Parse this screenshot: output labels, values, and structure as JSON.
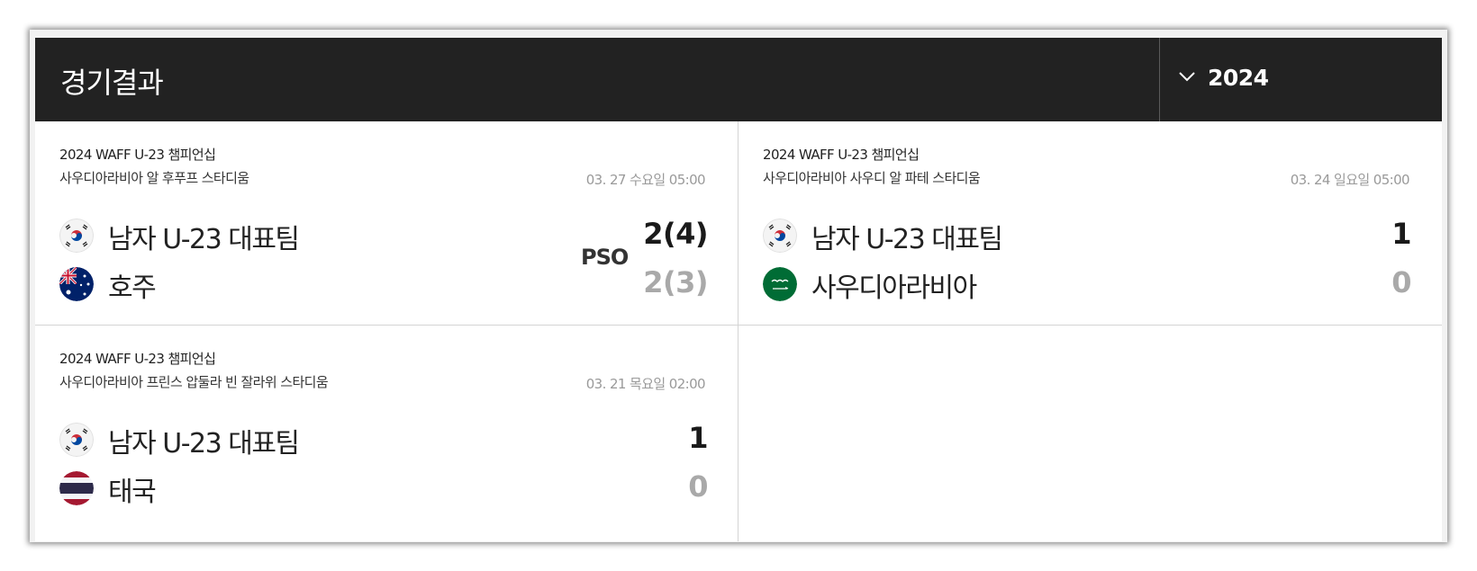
{
  "header": {
    "title": "경기결과",
    "year_selected": "2024"
  },
  "matches": [
    {
      "competition": "2024 WAFF U-23 챔피언십",
      "venue": "사우디아라비아 알 후푸프 스타디움",
      "datetime": "03. 27 수요일 05:00",
      "note": "PSO",
      "home": {
        "name": "남자 U-23 대표팀",
        "score": "2(4)",
        "flag": "korea-flag"
      },
      "away": {
        "name": "호주",
        "score": "2(3)",
        "flag": "australia-flag"
      }
    },
    {
      "competition": "2024 WAFF U-23 챔피언십",
      "venue": "사우디아라비아 사우디 알 파테 스타디움",
      "datetime": "03. 24 일요일 05:00",
      "home": {
        "name": "남자 U-23 대표팀",
        "score": "1",
        "flag": "korea-flag"
      },
      "away": {
        "name": "사우디아라비아",
        "score": "0",
        "flag": "saudi-arabia-flag"
      }
    },
    {
      "competition": "2024 WAFF U-23 챔피언십",
      "venue": "사우디아라비아 프린스 압둘라 빈 잘라위 스타디움",
      "datetime": "03. 21 목요일 02:00",
      "home": {
        "name": "남자 U-23 대표팀",
        "score": "1",
        "flag": "korea-flag"
      },
      "away": {
        "name": "태국",
        "score": "0",
        "flag": "thailand-flag"
      }
    }
  ],
  "colors": {
    "header_bg": "#222222",
    "winner_score": "#1a1a1a",
    "loser_score": "#a9a9a9",
    "date_text": "#9a9a9a"
  }
}
